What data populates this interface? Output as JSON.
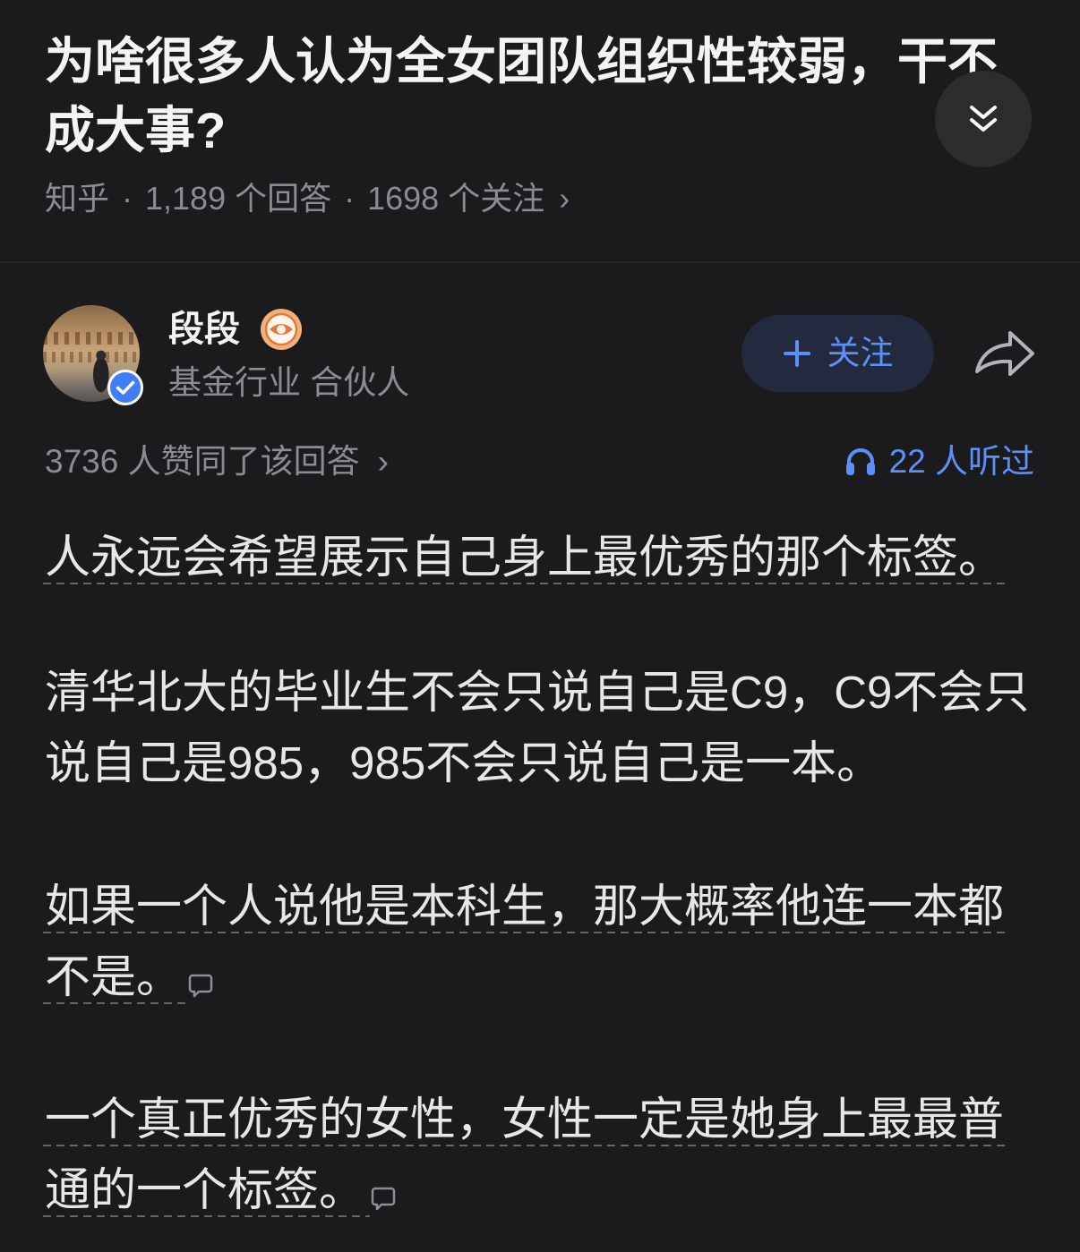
{
  "question": {
    "title_lines": [
      "为啥很多人认为全女团队组织性较弱，干不",
      "成大事?"
    ],
    "collapse_icon": "double-chevron-down-icon",
    "meta": {
      "source": "知乎",
      "separator": "·",
      "answers": "1,189 个回答",
      "followers": "1698 个关注",
      "chevron": "›"
    }
  },
  "author": {
    "verified_icon": "verified-check-icon",
    "name": "段段",
    "badge_icon": "eye-badge-icon",
    "headline": "基金行业 合伙人",
    "follow_button": {
      "icon": "plus-icon",
      "label": "关注"
    },
    "share_icon": "share-arrow-icon"
  },
  "stats": {
    "upvotes": "3736 人赞同了该回答",
    "upvotes_chevron": "›",
    "listen_icon": "headphones-icon",
    "listeners": "22 人听过"
  },
  "content": {
    "paragraphs": [
      {
        "lines": [
          {
            "text": "人永远会希望展示自己身上最优秀的那个标签。",
            "underlined": true
          }
        ]
      },
      {
        "lines": [
          {
            "text": "清华北大的毕业生不会只说自己是C9，C9不会只",
            "underlined": false
          },
          {
            "text": "说自己是985，985不会只说自己是一本。",
            "underlined": false
          }
        ]
      },
      {
        "lines": [
          {
            "text": "如果一个人说他是本科生，那大概率他连一本都",
            "underlined": true
          },
          {
            "text": "不是。",
            "underlined": true
          }
        ],
        "comment_icon": "comment-icon"
      },
      {
        "lines": [
          {
            "text": "一个真正优秀的女性，女性一定是她身上最最普",
            "underlined": true
          },
          {
            "text": "通的一个标签。",
            "underlined": true
          }
        ],
        "comment_icon": "comment-icon"
      }
    ]
  },
  "colors": {
    "background": "#1b1b1d",
    "accent_blue": "#5b8ff9",
    "follow_button_bg": "#232a3d",
    "primary_text": "#e7e7e9",
    "secondary_text": "#8b8b90"
  }
}
